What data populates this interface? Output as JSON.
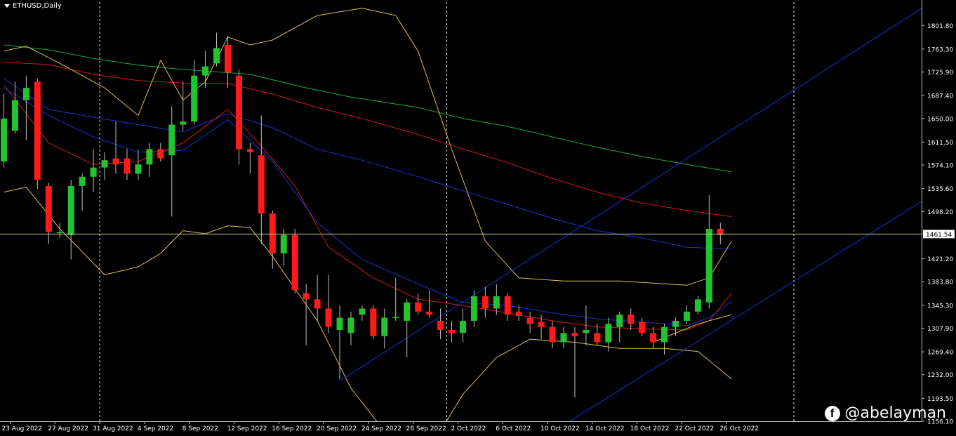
{
  "header": {
    "symbol_label": "ETHUSD,Daily"
  },
  "watermark": {
    "icon": "facebook-icon",
    "handle": "@abelayman"
  },
  "colors": {
    "background": "#000000",
    "bull": "#22c32e",
    "bear": "#ff1a1a",
    "wick": "#c0c0c0",
    "axis": "#c0c0c0",
    "ma_green": "#1fa83a",
    "ma_red": "#d11a1a",
    "ma_blue": "#2030d0",
    "bands": "#d8c050",
    "channel": "#1c2fd6",
    "price_line": "#c8c890"
  },
  "chart_data": {
    "type": "candlestick",
    "symbol": "ETHUSD",
    "timeframe": "Daily",
    "ylim": [
      1156.1,
      1839.9
    ],
    "y_ticks": [
      "1801.80",
      "1763.30",
      "1725.90",
      "1687.40",
      "1650.00",
      "1611.50",
      "1574.10",
      "1535.60",
      "1498.20",
      "1461.54",
      "1421.20",
      "1383.80",
      "1345.30",
      "1307.90",
      "1269.40",
      "1232.00",
      "1193.50",
      "1156.10"
    ],
    "current_price": "1461.54",
    "x_labels": [
      {
        "index": 1,
        "label": "23 Aug 2022"
      },
      {
        "index": 5,
        "label": "27 Aug 2022"
      },
      {
        "index": 9,
        "label": "31 Aug 2022"
      },
      {
        "index": 13,
        "label": "4 Sep 2022"
      },
      {
        "index": 17,
        "label": "8 Sep 2022"
      },
      {
        "index": 21,
        "label": "12 Sep 2022"
      },
      {
        "index": 25,
        "label": "16 Sep 2022"
      },
      {
        "index": 29,
        "label": "20 Sep 2022"
      },
      {
        "index": 33,
        "label": "24 Sep 2022"
      },
      {
        "index": 37,
        "label": "28 Sep 2022"
      },
      {
        "index": 41,
        "label": "2 Oct 2022"
      },
      {
        "index": 45,
        "label": "6 Oct 2022"
      },
      {
        "index": 49,
        "label": "10 Oct 2022"
      },
      {
        "index": 53,
        "label": "14 Oct 2022"
      },
      {
        "index": 57,
        "label": "18 Oct 2022"
      },
      {
        "index": 61,
        "label": "22 Oct 2022"
      },
      {
        "index": 65,
        "label": "26 Oct 2022"
      }
    ],
    "vertical_separators": [
      9,
      40,
      71
    ],
    "candles": [
      {
        "o": 1580,
        "h": 1690,
        "l": 1570,
        "c": 1650
      },
      {
        "o": 1630,
        "h": 1710,
        "l": 1625,
        "c": 1680
      },
      {
        "o": 1680,
        "h": 1720,
        "l": 1615,
        "c": 1700
      },
      {
        "o": 1710,
        "h": 1715,
        "l": 1535,
        "c": 1550
      },
      {
        "o": 1540,
        "h": 1545,
        "l": 1445,
        "c": 1465
      },
      {
        "o": 1463,
        "h": 1480,
        "l": 1455,
        "c": 1465
      },
      {
        "o": 1460,
        "h": 1550,
        "l": 1420,
        "c": 1540
      },
      {
        "o": 1540,
        "h": 1560,
        "l": 1500,
        "c": 1555
      },
      {
        "o": 1555,
        "h": 1600,
        "l": 1530,
        "c": 1570
      },
      {
        "o": 1570,
        "h": 1595,
        "l": 1550,
        "c": 1582
      },
      {
        "o": 1585,
        "h": 1645,
        "l": 1560,
        "c": 1575
      },
      {
        "o": 1585,
        "h": 1600,
        "l": 1550,
        "c": 1560
      },
      {
        "o": 1560,
        "h": 1600,
        "l": 1550,
        "c": 1575
      },
      {
        "o": 1575,
        "h": 1610,
        "l": 1555,
        "c": 1600
      },
      {
        "o": 1600,
        "h": 1610,
        "l": 1580,
        "c": 1585
      },
      {
        "o": 1590,
        "h": 1670,
        "l": 1490,
        "c": 1640
      },
      {
        "o": 1640,
        "h": 1710,
        "l": 1630,
        "c": 1645
      },
      {
        "o": 1645,
        "h": 1745,
        "l": 1640,
        "c": 1720
      },
      {
        "o": 1720,
        "h": 1760,
        "l": 1700,
        "c": 1735
      },
      {
        "o": 1740,
        "h": 1790,
        "l": 1735,
        "c": 1765
      },
      {
        "o": 1770,
        "h": 1785,
        "l": 1700,
        "c": 1725
      },
      {
        "o": 1720,
        "h": 1730,
        "l": 1575,
        "c": 1600
      },
      {
        "o": 1600,
        "h": 1610,
        "l": 1560,
        "c": 1595
      },
      {
        "o": 1590,
        "h": 1655,
        "l": 1445,
        "c": 1495
      },
      {
        "o": 1495,
        "h": 1500,
        "l": 1405,
        "c": 1430
      },
      {
        "o": 1430,
        "h": 1470,
        "l": 1410,
        "c": 1460
      },
      {
        "o": 1460,
        "h": 1470,
        "l": 1365,
        "c": 1370
      },
      {
        "o": 1365,
        "h": 1380,
        "l": 1280,
        "c": 1355
      },
      {
        "o": 1355,
        "h": 1395,
        "l": 1320,
        "c": 1340
      },
      {
        "o": 1340,
        "h": 1395,
        "l": 1300,
        "c": 1310
      },
      {
        "o": 1305,
        "h": 1345,
        "l": 1225,
        "c": 1325
      },
      {
        "o": 1300,
        "h": 1335,
        "l": 1280,
        "c": 1325
      },
      {
        "o": 1330,
        "h": 1345,
        "l": 1320,
        "c": 1340
      },
      {
        "o": 1340,
        "h": 1345,
        "l": 1290,
        "c": 1295
      },
      {
        "o": 1295,
        "h": 1340,
        "l": 1275,
        "c": 1325
      },
      {
        "o": 1325,
        "h": 1390,
        "l": 1320,
        "c": 1326
      },
      {
        "o": 1320,
        "h": 1355,
        "l": 1260,
        "c": 1350
      },
      {
        "o": 1350,
        "h": 1365,
        "l": 1330,
        "c": 1335
      },
      {
        "o": 1335,
        "h": 1370,
        "l": 1325,
        "c": 1330
      },
      {
        "o": 1320,
        "h": 1340,
        "l": 1290,
        "c": 1305
      },
      {
        "o": 1305,
        "h": 1320,
        "l": 1285,
        "c": 1300
      },
      {
        "o": 1300,
        "h": 1340,
        "l": 1285,
        "c": 1320
      },
      {
        "o": 1320,
        "h": 1370,
        "l": 1310,
        "c": 1360
      },
      {
        "o": 1360,
        "h": 1375,
        "l": 1325,
        "c": 1340
      },
      {
        "o": 1340,
        "h": 1380,
        "l": 1330,
        "c": 1360
      },
      {
        "o": 1360,
        "h": 1365,
        "l": 1320,
        "c": 1330
      },
      {
        "o": 1335,
        "h": 1345,
        "l": 1320,
        "c": 1328
      },
      {
        "o": 1325,
        "h": 1335,
        "l": 1300,
        "c": 1315
      },
      {
        "o": 1318,
        "h": 1330,
        "l": 1290,
        "c": 1310
      },
      {
        "o": 1310,
        "h": 1320,
        "l": 1275,
        "c": 1285
      },
      {
        "o": 1285,
        "h": 1310,
        "l": 1275,
        "c": 1300
      },
      {
        "o": 1300,
        "h": 1310,
        "l": 1195,
        "c": 1295
      },
      {
        "o": 1300,
        "h": 1345,
        "l": 1280,
        "c": 1305
      },
      {
        "o": 1300,
        "h": 1315,
        "l": 1280,
        "c": 1285
      },
      {
        "o": 1285,
        "h": 1325,
        "l": 1270,
        "c": 1315
      },
      {
        "o": 1310,
        "h": 1335,
        "l": 1285,
        "c": 1330
      },
      {
        "o": 1330,
        "h": 1340,
        "l": 1305,
        "c": 1315
      },
      {
        "o": 1318,
        "h": 1325,
        "l": 1295,
        "c": 1300
      },
      {
        "o": 1300,
        "h": 1310,
        "l": 1275,
        "c": 1285
      },
      {
        "o": 1285,
        "h": 1315,
        "l": 1265,
        "c": 1310
      },
      {
        "o": 1310,
        "h": 1325,
        "l": 1295,
        "c": 1320
      },
      {
        "o": 1320,
        "h": 1345,
        "l": 1315,
        "c": 1335
      },
      {
        "o": 1335,
        "h": 1360,
        "l": 1330,
        "c": 1355
      },
      {
        "o": 1350,
        "h": 1525,
        "l": 1340,
        "c": 1470
      },
      {
        "o": 1470,
        "h": 1480,
        "l": 1445,
        "c": 1460
      }
    ],
    "indicators": [
      {
        "role": "ma-long",
        "color_key": "ma_green",
        "values": [
          {
            "i": 0,
            "v": 1770
          },
          {
            "i": 4,
            "v": 1762
          },
          {
            "i": 8,
            "v": 1748
          },
          {
            "i": 12,
            "v": 1737
          },
          {
            "i": 16,
            "v": 1730
          },
          {
            "i": 22,
            "v": 1722
          },
          {
            "i": 27,
            "v": 1700
          },
          {
            "i": 31,
            "v": 1685
          },
          {
            "i": 37,
            "v": 1668
          },
          {
            "i": 41,
            "v": 1650
          },
          {
            "i": 45,
            "v": 1637
          },
          {
            "i": 49,
            "v": 1620
          },
          {
            "i": 53,
            "v": 1603
          },
          {
            "i": 57,
            "v": 1588
          },
          {
            "i": 61,
            "v": 1575
          },
          {
            "i": 65,
            "v": 1563
          }
        ]
      },
      {
        "i_note": "",
        "role": "ma-mid",
        "color_key": "ma_red",
        "values": [
          {
            "i": 0,
            "v": 1742
          },
          {
            "i": 4,
            "v": 1738
          },
          {
            "i": 8,
            "v": 1722
          },
          {
            "i": 12,
            "v": 1712
          },
          {
            "i": 16,
            "v": 1708
          },
          {
            "i": 20,
            "v": 1707
          },
          {
            "i": 24,
            "v": 1690
          },
          {
            "i": 28,
            "v": 1668
          },
          {
            "i": 32,
            "v": 1650
          },
          {
            "i": 37,
            "v": 1624
          },
          {
            "i": 41,
            "v": 1600
          },
          {
            "i": 45,
            "v": 1578
          },
          {
            "i": 49,
            "v": 1552
          },
          {
            "i": 53,
            "v": 1530
          },
          {
            "i": 57,
            "v": 1512
          },
          {
            "i": 61,
            "v": 1500
          },
          {
            "i": 65,
            "v": 1490
          }
        ]
      },
      {
        "role": "ma-short",
        "color_key": "ma_blue",
        "values": [
          {
            "i": 0,
            "v": 1715
          },
          {
            "i": 4,
            "v": 1665
          },
          {
            "i": 8,
            "v": 1652
          },
          {
            "i": 12,
            "v": 1640
          },
          {
            "i": 16,
            "v": 1628
          },
          {
            "i": 20,
            "v": 1658
          },
          {
            "i": 24,
            "v": 1635
          },
          {
            "i": 28,
            "v": 1600
          },
          {
            "i": 32,
            "v": 1582
          },
          {
            "i": 37,
            "v": 1555
          },
          {
            "i": 41,
            "v": 1532
          },
          {
            "i": 45,
            "v": 1510
          },
          {
            "i": 49,
            "v": 1487
          },
          {
            "i": 53,
            "v": 1467
          },
          {
            "i": 57,
            "v": 1455
          },
          {
            "i": 61,
            "v": 1440
          },
          {
            "i": 65,
            "v": 1437
          }
        ]
      },
      {
        "role": "bb-mid",
        "color_key": "ma_red",
        "values": [
          {
            "i": 0,
            "v": 1705
          },
          {
            "i": 4,
            "v": 1610
          },
          {
            "i": 8,
            "v": 1575
          },
          {
            "i": 12,
            "v": 1580
          },
          {
            "i": 16,
            "v": 1610
          },
          {
            "i": 20,
            "v": 1665
          },
          {
            "i": 23,
            "v": 1605
          },
          {
            "i": 26,
            "v": 1540
          },
          {
            "i": 29,
            "v": 1440
          },
          {
            "i": 33,
            "v": 1390
          },
          {
            "i": 37,
            "v": 1355
          },
          {
            "i": 41,
            "v": 1345
          },
          {
            "i": 45,
            "v": 1333
          },
          {
            "i": 49,
            "v": 1320
          },
          {
            "i": 53,
            "v": 1310
          },
          {
            "i": 57,
            "v": 1307
          },
          {
            "i": 61,
            "v": 1305
          },
          {
            "i": 63,
            "v": 1320
          },
          {
            "i": 65,
            "v": 1365
          }
        ]
      },
      {
        "role": "bb-ma",
        "color_key": "ma_blue",
        "values": [
          {
            "i": 0,
            "v": 1700
          },
          {
            "i": 4,
            "v": 1655
          },
          {
            "i": 8,
            "v": 1620
          },
          {
            "i": 12,
            "v": 1595
          },
          {
            "i": 16,
            "v": 1598
          },
          {
            "i": 20,
            "v": 1648
          },
          {
            "i": 24,
            "v": 1580
          },
          {
            "i": 28,
            "v": 1480
          },
          {
            "i": 32,
            "v": 1420
          },
          {
            "i": 37,
            "v": 1380
          },
          {
            "i": 41,
            "v": 1350
          },
          {
            "i": 45,
            "v": 1345
          },
          {
            "i": 49,
            "v": 1333
          },
          {
            "i": 53,
            "v": 1323
          },
          {
            "i": 57,
            "v": 1318
          },
          {
            "i": 61,
            "v": 1312
          },
          {
            "i": 63,
            "v": 1325
          },
          {
            "i": 65,
            "v": 1352
          }
        ]
      },
      {
        "role": "bb-upper",
        "color_key": "bands",
        "values": [
          {
            "i": 0,
            "v": 1760
          },
          {
            "i": 2,
            "v": 1768
          },
          {
            "i": 5,
            "v": 1740
          },
          {
            "i": 9,
            "v": 1700
          },
          {
            "i": 12,
            "v": 1655
          },
          {
            "i": 14,
            "v": 1745
          },
          {
            "i": 16,
            "v": 1680
          },
          {
            "i": 18,
            "v": 1710
          },
          {
            "i": 20,
            "v": 1783
          },
          {
            "i": 22,
            "v": 1770
          },
          {
            "i": 24,
            "v": 1778
          },
          {
            "i": 28,
            "v": 1818
          },
          {
            "i": 32,
            "v": 1830
          },
          {
            "i": 35,
            "v": 1818
          },
          {
            "i": 37,
            "v": 1760
          },
          {
            "i": 40,
            "v": 1600
          },
          {
            "i": 43,
            "v": 1450
          },
          {
            "i": 46,
            "v": 1390
          },
          {
            "i": 50,
            "v": 1385
          },
          {
            "i": 55,
            "v": 1385
          },
          {
            "i": 61,
            "v": 1378
          },
          {
            "i": 63,
            "v": 1390
          },
          {
            "i": 65,
            "v": 1450
          }
        ]
      },
      {
        "role": "bb-lower",
        "color_key": "bands",
        "values": [
          {
            "i": 0,
            "v": 1530
          },
          {
            "i": 2,
            "v": 1538
          },
          {
            "i": 5,
            "v": 1470
          },
          {
            "i": 9,
            "v": 1395
          },
          {
            "i": 12,
            "v": 1408
          },
          {
            "i": 14,
            "v": 1430
          },
          {
            "i": 16,
            "v": 1467
          },
          {
            "i": 18,
            "v": 1462
          },
          {
            "i": 20,
            "v": 1475
          },
          {
            "i": 22,
            "v": 1472
          },
          {
            "i": 24,
            "v": 1425
          },
          {
            "i": 28,
            "v": 1320
          },
          {
            "i": 31,
            "v": 1210
          },
          {
            "i": 34,
            "v": 1140
          },
          {
            "i": 38,
            "v": 1110
          },
          {
            "i": 41,
            "v": 1200
          },
          {
            "i": 44,
            "v": 1260
          },
          {
            "i": 47,
            "v": 1290
          },
          {
            "i": 51,
            "v": 1285
          },
          {
            "i": 55,
            "v": 1275
          },
          {
            "i": 59,
            "v": 1275
          },
          {
            "i": 62,
            "v": 1270
          },
          {
            "i": 64,
            "v": 1240
          },
          {
            "i": 65,
            "v": 1225
          }
        ]
      },
      {
        "role": "envelope-inner",
        "color_key": "bands",
        "values": [
          {
            "i": 58,
            "v": 1285
          },
          {
            "i": 60,
            "v": 1300
          },
          {
            "i": 62,
            "v": 1315
          },
          {
            "i": 64,
            "v": 1325
          },
          {
            "i": 65,
            "v": 1330
          }
        ]
      }
    ],
    "trend_channel": [
      {
        "from": {
          "i": 30,
          "v": 1222
        },
        "to": {
          "i": 82,
          "v": 1830
        }
      },
      {
        "from": {
          "i": 50,
          "v": 1150
        },
        "to": {
          "i": 82,
          "v": 1515
        }
      }
    ]
  }
}
